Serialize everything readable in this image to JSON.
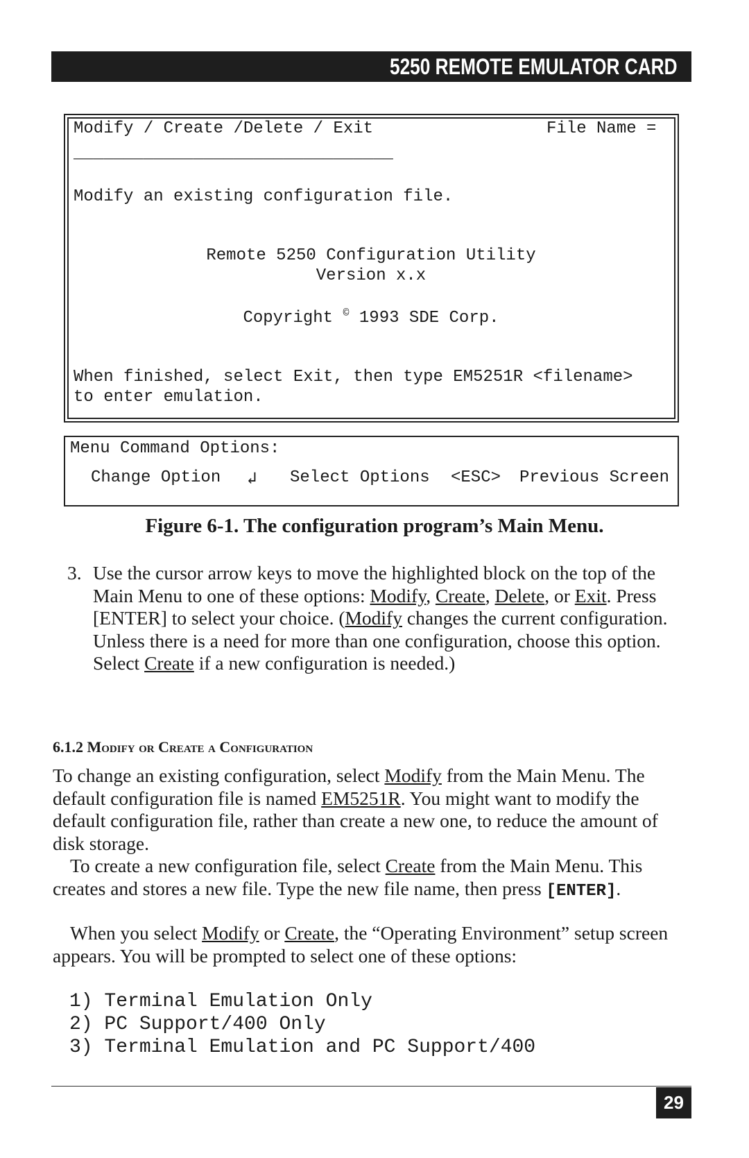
{
  "header": {
    "title": "5250 REMOTE EMULATOR CARD"
  },
  "screen": {
    "menu_bar": "Modify / Create /Delete / Exit",
    "file_name_label": "File Name =",
    "underline": "________________________________",
    "description": "Modify an existing configuration file.",
    "utility_title": "Remote 5250 Configuration Utility",
    "version": "Version x.x",
    "copyright_prefix": "Copyright",
    "copyright_symbol": "©",
    "copyright_suffix": "1993 SDE Corp.",
    "finish_line1": "When finished, select Exit, then type EM5251R <filename>",
    "finish_line2": "to enter emulation."
  },
  "commands": {
    "title": "Menu Command Options:",
    "change_option": "Change Option",
    "enter_symbol": "↲",
    "select_options": "Select Options",
    "esc": "<ESC>",
    "previous_screen": "Previous Screen"
  },
  "caption": "Figure 6-1. The configuration program’s Main Menu.",
  "step3": {
    "number": "3.",
    "t1": "Use the cursor arrow keys to move the highlighted block on the top of the Main Menu to one of these options: ",
    "modify": "Modify",
    "c1": ", ",
    "create": "Create",
    "c2": ", ",
    "delete": "Delete",
    "c3": ", or ",
    "exit": "Exit",
    "t2": ". Press [ENTER] to select your choice. (",
    "modify2": "Modify",
    "t3": " changes the current configuration. Unless there is a need for more than one configuration, choose this option. Select ",
    "create2": "Create",
    "t4": " if a new configuration is needed.)"
  },
  "section": {
    "number": "6.1.2",
    "title": "Modify or Create a Configuration"
  },
  "para1": {
    "t1": "To change an existing configuration, select ",
    "modify": "Modify",
    "t2": " from the Main Menu. The default configuration file is named ",
    "file": "EM5251R",
    "t3": ". You might want to modify the default configuration file, rather than create a new one, to reduce the amount of disk storage."
  },
  "para2": {
    "t1": "To create a new configuration file, select ",
    "create": "Create",
    "t2": " from the Main Menu. This creates and stores a new file. Type the new file name, then press ",
    "key": "[ENTER]",
    "t3": "."
  },
  "para3": {
    "t1": "When you select ",
    "modify": "Modify",
    "t2": " or ",
    "create": "Create",
    "t3": ", the “Operating Environment” setup screen appears. You will be prompted to select one of these options:"
  },
  "options": [
    "1) Terminal Emulation Only",
    "2) PC Support/400 Only",
    "3) Terminal Emulation and PC Support/400"
  ],
  "page_number": "29"
}
